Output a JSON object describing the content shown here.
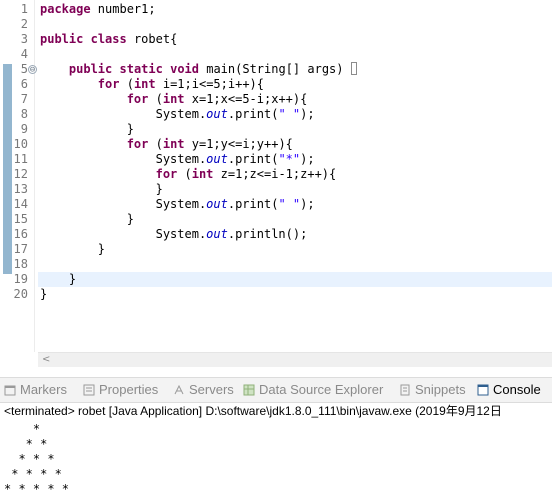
{
  "editor": {
    "line_numbers": [
      "1",
      "2",
      "3",
      "4",
      "5",
      "6",
      "7",
      "8",
      "9",
      "10",
      "11",
      "12",
      "13",
      "14",
      "15",
      "16",
      "17",
      "18",
      "19",
      "20"
    ],
    "fold_marker": "⊖",
    "code": {
      "l1_kw": "package",
      "l1_rest": " number1;",
      "l3_kw1": "public",
      "l3_kw2": "class",
      "l3_rest": " robet{",
      "l5_kw1": "public",
      "l5_kw2": "static",
      "l5_kw3": "void",
      "l5_rest": " main(String[] args) ",
      "l6_kw": "for",
      "l6_kw2": "int",
      "l6_rest": " i=1;i<=5;i++){",
      "l7_kw": "for",
      "l7_kw2": "int",
      "l7_rest": " x=1;x<=5-i;x++){",
      "l8_pre": "System.",
      "l8_it": "out",
      "l8_mid": ".print(",
      "l8_str": "\" \"",
      "l8_end": ");",
      "l9": "}",
      "l10_kw": "for",
      "l10_kw2": "int",
      "l10_rest": " y=1;y<=i;y++){",
      "l11_pre": "System.",
      "l11_it": "out",
      "l11_mid": ".print(",
      "l11_str": "\"*\"",
      "l11_end": ");",
      "l12_kw": "for",
      "l12_kw2": "int",
      "l12_rest": " z=1;z<=i-1;z++){",
      "l13": "}",
      "l14_pre": "System.",
      "l14_it": "out",
      "l14_mid": ".print(",
      "l14_str": "\" \"",
      "l14_end": ");",
      "l15": "}",
      "l16_pre": "System.",
      "l16_it": "out",
      "l16_end": ".println();",
      "l17": "}",
      "l19": "}",
      "l20": "}"
    },
    "scroll_left": "<"
  },
  "tabs": [
    {
      "label": "Markers",
      "icon": "markers-icon"
    },
    {
      "label": "Properties",
      "icon": "properties-icon"
    },
    {
      "label": "Servers",
      "icon": "servers-icon"
    },
    {
      "label": "Data Source Explorer",
      "icon": "data-source-icon"
    },
    {
      "label": "Snippets",
      "icon": "snippets-icon"
    },
    {
      "label": "Console",
      "icon": "console-icon",
      "active": true
    }
  ],
  "console": {
    "status": "<terminated> robet [Java Application] D:\\software\\jdk1.8.0_111\\bin\\javaw.exe (2019年9月12日",
    "output": [
      "    *",
      "   * *",
      "  * * *",
      " * * * *",
      "* * * * *"
    ]
  },
  "colors": {
    "keyword": "#7f0055",
    "string": "#2a00ff",
    "field": "#0000c0",
    "ruler_mark": "#93b6cf"
  }
}
